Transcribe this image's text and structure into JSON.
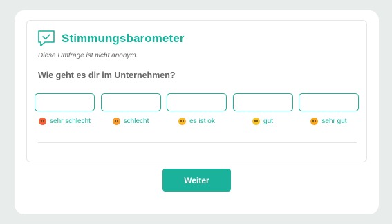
{
  "survey": {
    "title": "Stimmungsbarometer",
    "subtitle": "Diese Umfrage ist nicht anonym.",
    "question": "Wie geht es dir im Unternehmen?",
    "options": [
      {
        "label": "sehr schlecht",
        "icon": "very-bad-emoji-icon",
        "color": "#f0623a"
      },
      {
        "label": "schlecht",
        "icon": "bad-emoji-icon",
        "color": "#f49a2e"
      },
      {
        "label": "es ist ok",
        "icon": "neutral-emoji-icon",
        "color": "#f5b82e"
      },
      {
        "label": "gut",
        "icon": "good-emoji-icon",
        "color": "#f5c230"
      },
      {
        "label": "sehr gut",
        "icon": "very-good-emoji-icon",
        "color": "#f5a623"
      }
    ]
  },
  "actions": {
    "next_label": "Weiter"
  },
  "colors": {
    "accent": "#1ab29b",
    "background": "#e8ecea"
  }
}
